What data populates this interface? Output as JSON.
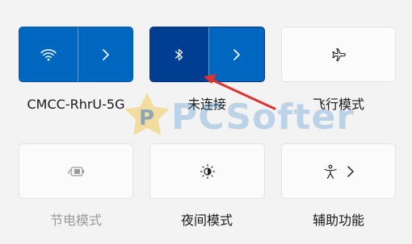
{
  "tiles": {
    "wifi": {
      "label": "CMCC-RhrU-5G",
      "icon": "wifi-icon"
    },
    "bluetooth": {
      "label": "未连接",
      "icon": "bluetooth-icon"
    },
    "airplane": {
      "label": "飞行模式",
      "icon": "airplane-icon"
    },
    "battery_saver": {
      "label": "节电模式",
      "icon": "battery-saver-icon"
    },
    "night_light": {
      "label": "夜间模式",
      "icon": "night-light-icon"
    },
    "accessibility": {
      "label": "辅助功能",
      "icon": "accessibility-icon"
    }
  },
  "watermark": {
    "text": "PCSofter"
  },
  "colors": {
    "accent": "#0067c0",
    "accent_dark": "#003e92",
    "annotation": "#e0322f"
  }
}
